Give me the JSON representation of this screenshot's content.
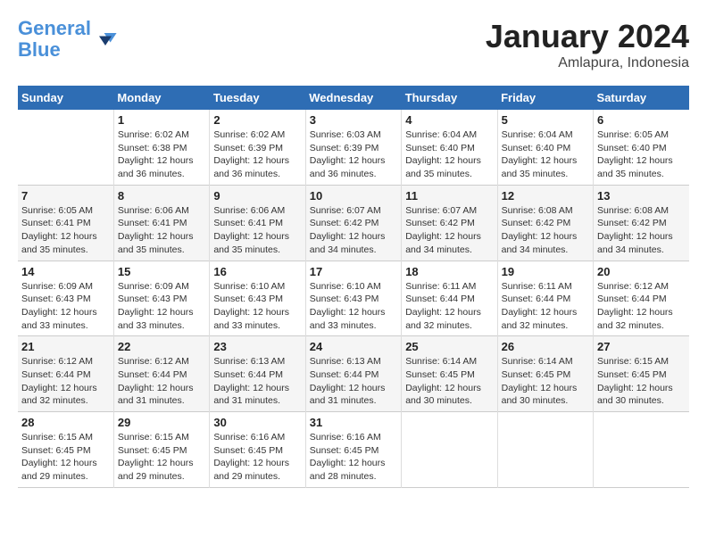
{
  "logo": {
    "line1": "General",
    "line2": "Blue"
  },
  "title": "January 2024",
  "subtitle": "Amlapura, Indonesia",
  "weekdays": [
    "Sunday",
    "Monday",
    "Tuesday",
    "Wednesday",
    "Thursday",
    "Friday",
    "Saturday"
  ],
  "weeks": [
    [
      {
        "day": "",
        "info": ""
      },
      {
        "day": "1",
        "info": "Sunrise: 6:02 AM\nSunset: 6:38 PM\nDaylight: 12 hours and 36 minutes."
      },
      {
        "day": "2",
        "info": "Sunrise: 6:02 AM\nSunset: 6:39 PM\nDaylight: 12 hours and 36 minutes."
      },
      {
        "day": "3",
        "info": "Sunrise: 6:03 AM\nSunset: 6:39 PM\nDaylight: 12 hours and 36 minutes."
      },
      {
        "day": "4",
        "info": "Sunrise: 6:04 AM\nSunset: 6:40 PM\nDaylight: 12 hours and 35 minutes."
      },
      {
        "day": "5",
        "info": "Sunrise: 6:04 AM\nSunset: 6:40 PM\nDaylight: 12 hours and 35 minutes."
      },
      {
        "day": "6",
        "info": "Sunrise: 6:05 AM\nSunset: 6:40 PM\nDaylight: 12 hours and 35 minutes."
      }
    ],
    [
      {
        "day": "7",
        "info": "Sunrise: 6:05 AM\nSunset: 6:41 PM\nDaylight: 12 hours and 35 minutes."
      },
      {
        "day": "8",
        "info": "Sunrise: 6:06 AM\nSunset: 6:41 PM\nDaylight: 12 hours and 35 minutes."
      },
      {
        "day": "9",
        "info": "Sunrise: 6:06 AM\nSunset: 6:41 PM\nDaylight: 12 hours and 35 minutes."
      },
      {
        "day": "10",
        "info": "Sunrise: 6:07 AM\nSunset: 6:42 PM\nDaylight: 12 hours and 34 minutes."
      },
      {
        "day": "11",
        "info": "Sunrise: 6:07 AM\nSunset: 6:42 PM\nDaylight: 12 hours and 34 minutes."
      },
      {
        "day": "12",
        "info": "Sunrise: 6:08 AM\nSunset: 6:42 PM\nDaylight: 12 hours and 34 minutes."
      },
      {
        "day": "13",
        "info": "Sunrise: 6:08 AM\nSunset: 6:42 PM\nDaylight: 12 hours and 34 minutes."
      }
    ],
    [
      {
        "day": "14",
        "info": "Sunrise: 6:09 AM\nSunset: 6:43 PM\nDaylight: 12 hours and 33 minutes."
      },
      {
        "day": "15",
        "info": "Sunrise: 6:09 AM\nSunset: 6:43 PM\nDaylight: 12 hours and 33 minutes."
      },
      {
        "day": "16",
        "info": "Sunrise: 6:10 AM\nSunset: 6:43 PM\nDaylight: 12 hours and 33 minutes."
      },
      {
        "day": "17",
        "info": "Sunrise: 6:10 AM\nSunset: 6:43 PM\nDaylight: 12 hours and 33 minutes."
      },
      {
        "day": "18",
        "info": "Sunrise: 6:11 AM\nSunset: 6:44 PM\nDaylight: 12 hours and 32 minutes."
      },
      {
        "day": "19",
        "info": "Sunrise: 6:11 AM\nSunset: 6:44 PM\nDaylight: 12 hours and 32 minutes."
      },
      {
        "day": "20",
        "info": "Sunrise: 6:12 AM\nSunset: 6:44 PM\nDaylight: 12 hours and 32 minutes."
      }
    ],
    [
      {
        "day": "21",
        "info": "Sunrise: 6:12 AM\nSunset: 6:44 PM\nDaylight: 12 hours and 32 minutes."
      },
      {
        "day": "22",
        "info": "Sunrise: 6:12 AM\nSunset: 6:44 PM\nDaylight: 12 hours and 31 minutes."
      },
      {
        "day": "23",
        "info": "Sunrise: 6:13 AM\nSunset: 6:44 PM\nDaylight: 12 hours and 31 minutes."
      },
      {
        "day": "24",
        "info": "Sunrise: 6:13 AM\nSunset: 6:44 PM\nDaylight: 12 hours and 31 minutes."
      },
      {
        "day": "25",
        "info": "Sunrise: 6:14 AM\nSunset: 6:45 PM\nDaylight: 12 hours and 30 minutes."
      },
      {
        "day": "26",
        "info": "Sunrise: 6:14 AM\nSunset: 6:45 PM\nDaylight: 12 hours and 30 minutes."
      },
      {
        "day": "27",
        "info": "Sunrise: 6:15 AM\nSunset: 6:45 PM\nDaylight: 12 hours and 30 minutes."
      }
    ],
    [
      {
        "day": "28",
        "info": "Sunrise: 6:15 AM\nSunset: 6:45 PM\nDaylight: 12 hours and 29 minutes."
      },
      {
        "day": "29",
        "info": "Sunrise: 6:15 AM\nSunset: 6:45 PM\nDaylight: 12 hours and 29 minutes."
      },
      {
        "day": "30",
        "info": "Sunrise: 6:16 AM\nSunset: 6:45 PM\nDaylight: 12 hours and 29 minutes."
      },
      {
        "day": "31",
        "info": "Sunrise: 6:16 AM\nSunset: 6:45 PM\nDaylight: 12 hours and 28 minutes."
      },
      {
        "day": "",
        "info": ""
      },
      {
        "day": "",
        "info": ""
      },
      {
        "day": "",
        "info": ""
      }
    ]
  ]
}
